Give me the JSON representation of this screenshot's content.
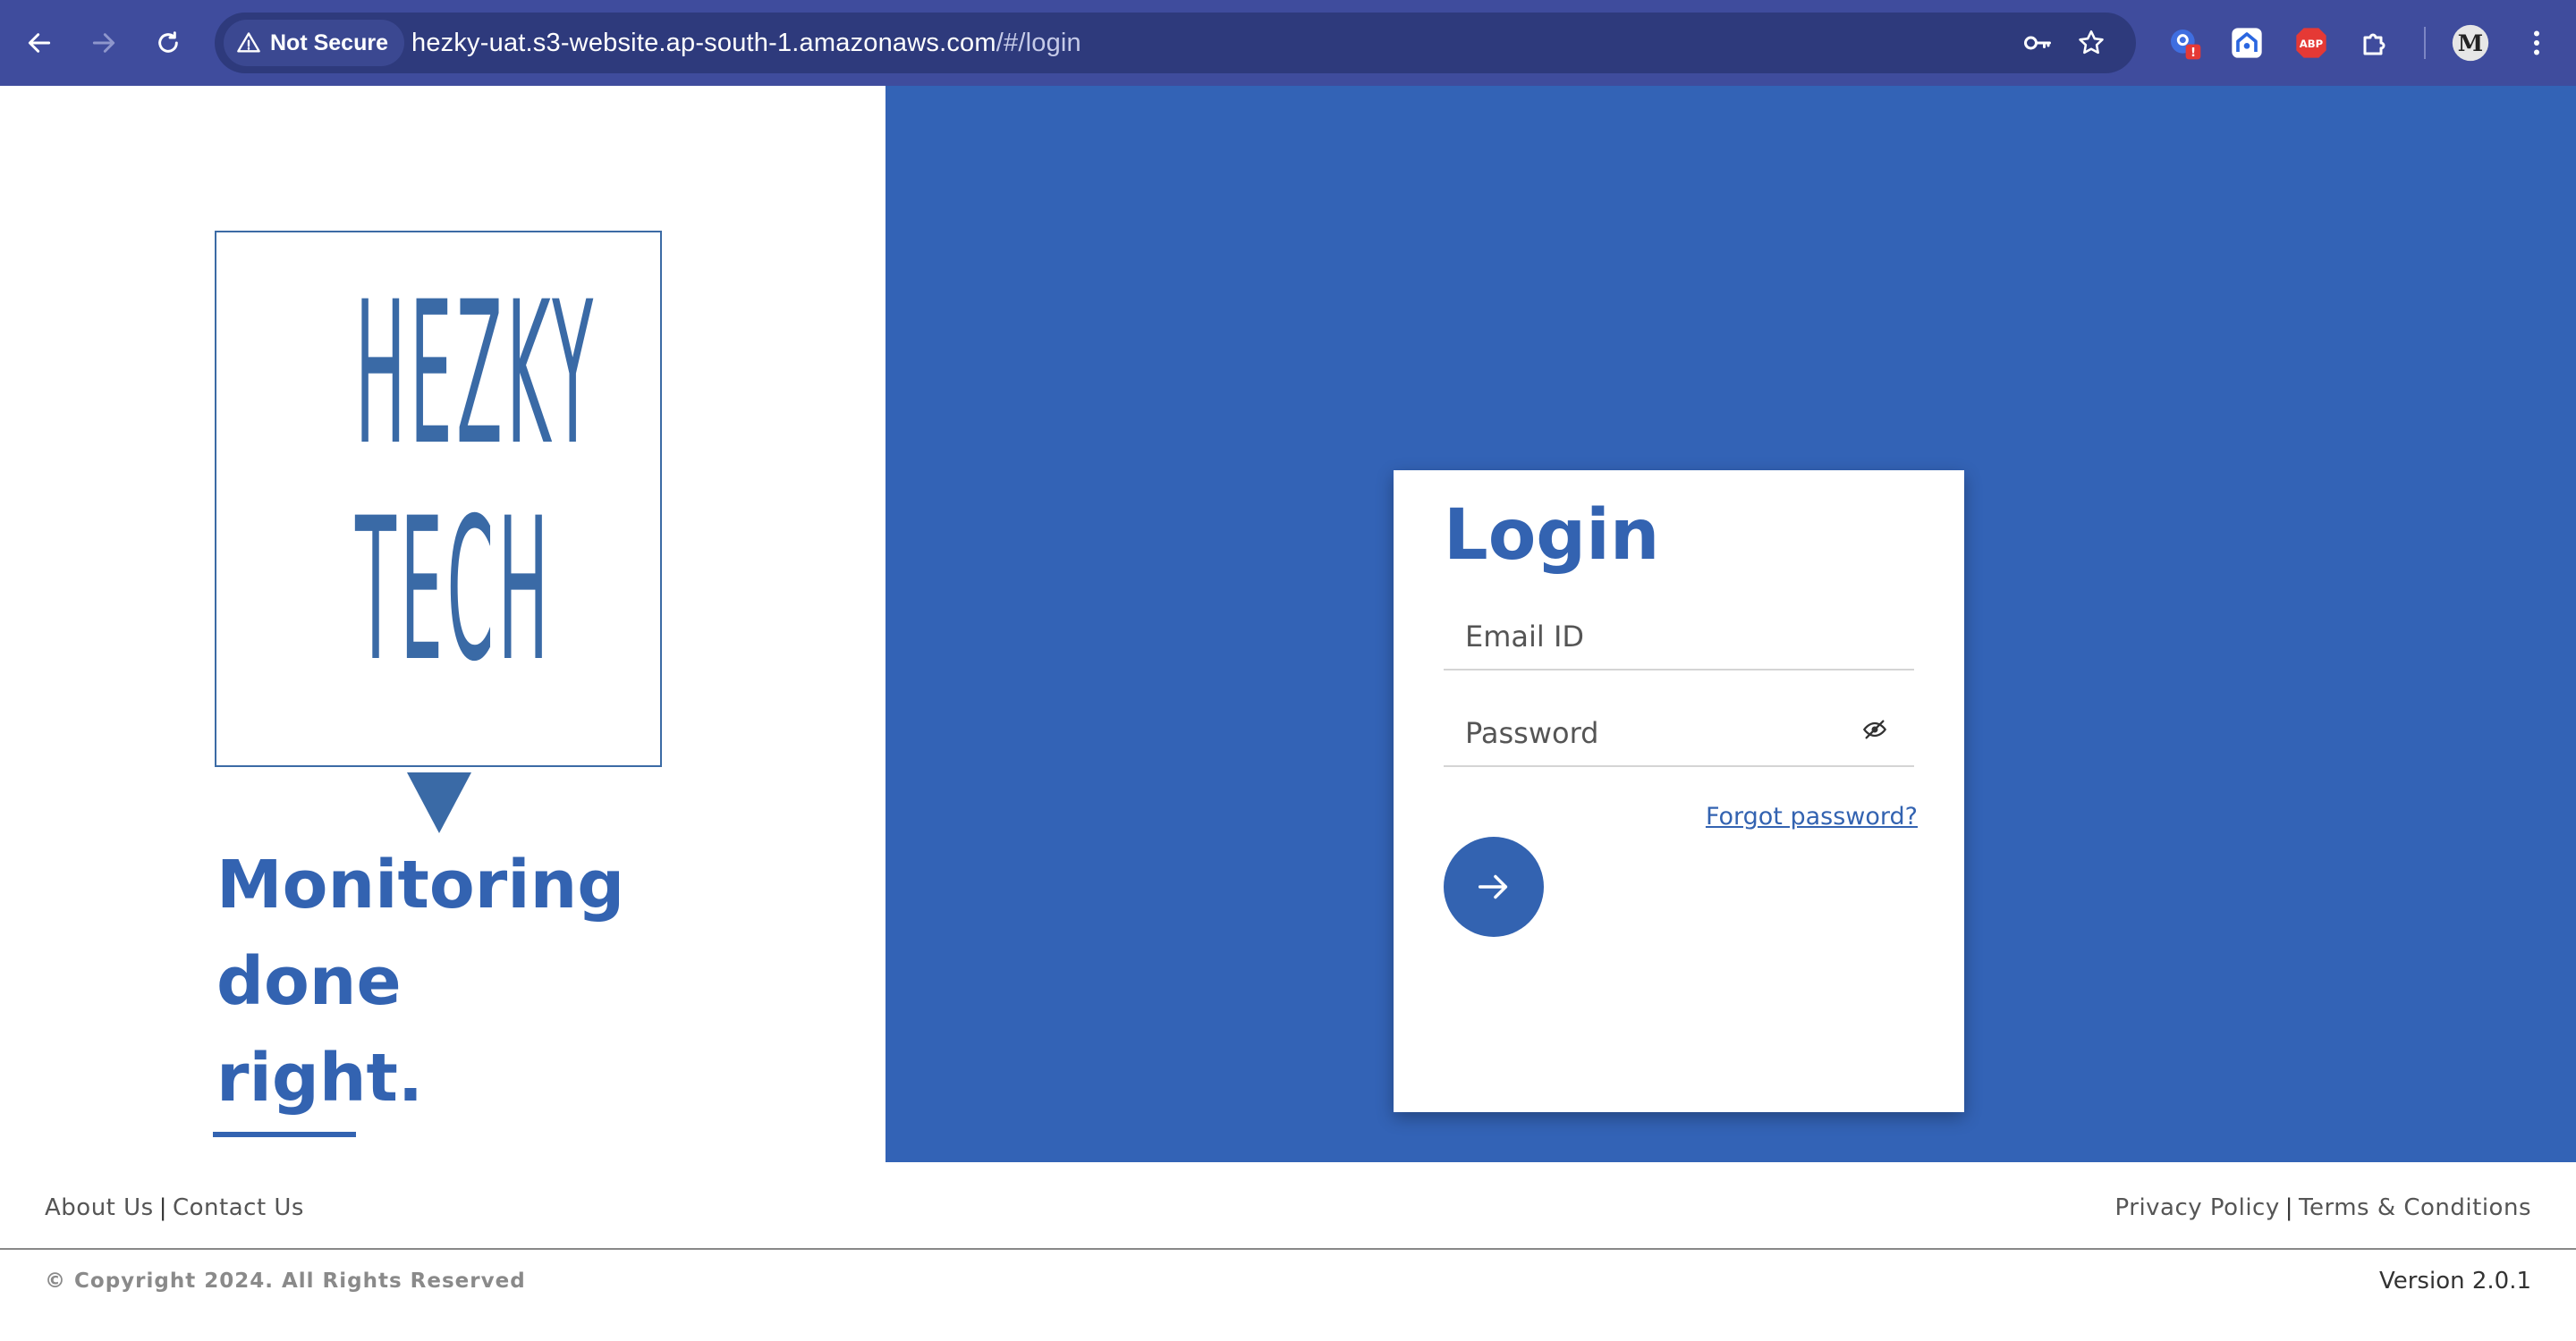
{
  "browser": {
    "security_label": "Not Secure",
    "url_host": "hezky-uat.s3-website.ap-south-1.amazonaws.com",
    "url_path": "/#/login",
    "icons": [
      "back-arrow-icon",
      "forward-arrow-icon",
      "reload-icon",
      "warning-triangle-icon",
      "key-icon",
      "star-icon",
      "extension-pin-icon",
      "extension-house-icon",
      "adblock-icon",
      "puzzle-icon",
      "profile-avatar",
      "kebab-menu-icon"
    ],
    "adblock_label": "ABP",
    "badge_label": "!",
    "profile_initial": "M"
  },
  "brand": {
    "logo_line1": "HEZKY",
    "logo_line2": "TECH",
    "tagline_line1": "Monitoring",
    "tagline_line2": "done",
    "tagline_line3": "right.",
    "color": "#3363b1"
  },
  "login": {
    "title": "Login",
    "email_placeholder": "Email ID",
    "email_value": "",
    "password_placeholder": "Password",
    "password_value": "",
    "forgot_label": "Forgot password?",
    "submit_icon": "arrow-right-icon"
  },
  "footer": {
    "about": "About Us",
    "contact": "Contact Us",
    "privacy": "Privacy Policy",
    "terms": "Terms & Conditions",
    "separator": "|",
    "copyright": "© Copyright 2024. All Rights Reserved",
    "version": "Version 2.0.1"
  },
  "colors": {
    "chrome": "#3f4c9d",
    "panel": "#3363b6",
    "accent": "#3363b1"
  }
}
